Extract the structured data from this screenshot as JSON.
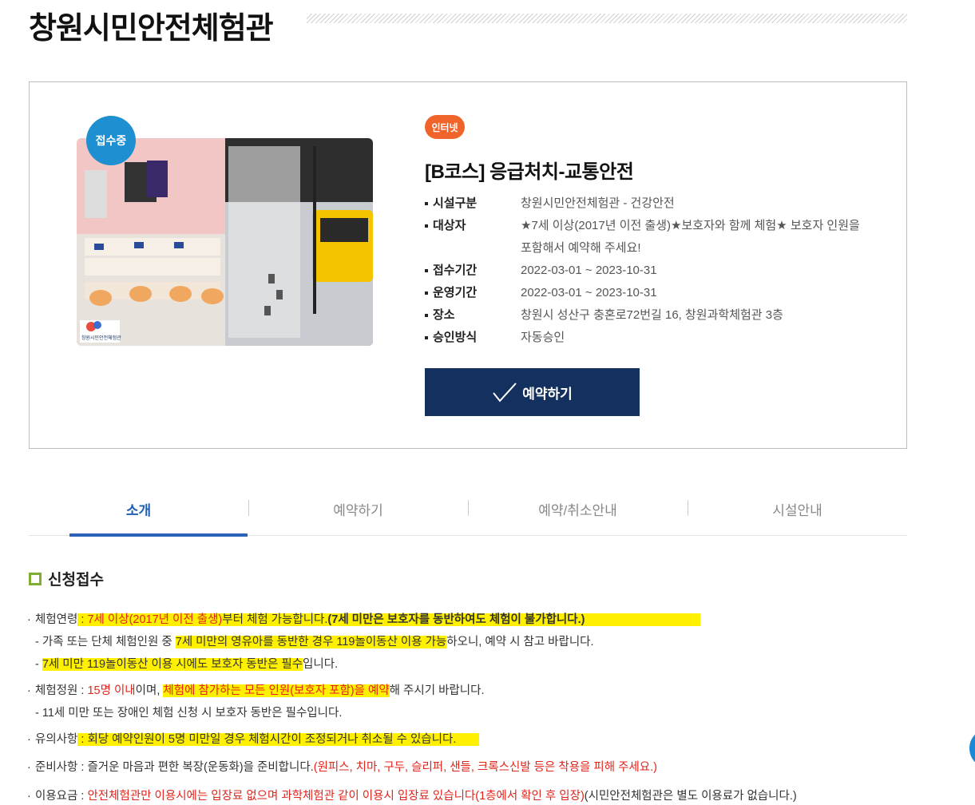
{
  "page": {
    "title": "창원시민안전체험관"
  },
  "card": {
    "status_badge": "접수중",
    "channel_chip": "인터넷",
    "course_title": "[B코스] 응급처치-교통안전",
    "photo_logo_text": "창원시민안전체험관",
    "info": [
      {
        "key": "시설구분",
        "value": "창원시민안전체험관 - 건강안전"
      },
      {
        "key": "대상자",
        "value": "★7세 이상(2017년 이전 출생)★보호자와 함께 체험★ 보호자 인원을",
        "value2": "포함해서 예약해 주세요!"
      },
      {
        "key": "접수기간",
        "value": "2022-03-01 ~ 2023-10-31"
      },
      {
        "key": "운영기간",
        "value": "2022-03-01 ~ 2023-10-31"
      },
      {
        "key": "장소",
        "value": "창원시 성산구 충혼로72번길 16, 창원과학체험관 3층"
      },
      {
        "key": "승인방식",
        "value": "자동승인"
      }
    ],
    "reserve_button": "예약하기"
  },
  "tabs": [
    "소개",
    "예약하기",
    "예약/취소안내",
    "시설안내"
  ],
  "section": {
    "title": "신청접수",
    "r1_label": "체험연령",
    "r1_red": "7세 이상(2017년 이전 출생)",
    "r1_rest": "부터 체험 가능합니다.",
    "r1_bold": "(7세 미만은 보호자를 동반하여도 체험이 불가합니다.)",
    "r1_sub1_a": "- 가족 또는 단체 체험인원 중 ",
    "r1_sub1_b": "7세 미만의 영유아를 동반한 경우 119놀이동산 이용 가능",
    "r1_sub1_c": "하오니, 예약 시 참고 바랍니다.",
    "r1_sub2_a": "- ",
    "r1_sub2_b": "7세 미만 119놀이동산 이용 시에도 보호자 동반은 필수",
    "r1_sub2_c": "입니다.",
    "r2_label": "체험정원",
    "r2_red": "15명 이내",
    "r2_mid": "이며, ",
    "r2_hl": "체험에 참가하는 모든 인원(보호자 포함)을 예약",
    "r2_rest": "해 주시기 바랍니다.",
    "r2_sub": "- 11세 미만 또는 장애인 체험 신청 시 보호자 동반은 필수입니다.",
    "r3_label": "유의사항",
    "r3_text": "회당 예약인원이 5명 미만일 경우 체험시간이 조정되거나 취소될 수 있습니다.",
    "r4_label": "준비사항",
    "r4_text": "즐거운 마음과 편한 복장(운동화)을 준비합니다.",
    "r4_red": "(원피스, 치마, 구두, 슬리퍼, 샌들, 크록스신발 등은 착용을 피해 주세요.)",
    "r5_label": "이용요금",
    "r5_red": "안전체험관만 이용시에는 입장료 없으며 과학체험관 같이 이용시 입장료 있습니다(1층에서 확인 후 입장)",
    "r5_rest": "(시민안전체험관은 별도 이용료가 없습니다.)"
  },
  "colors": {
    "accent_blue": "#14305e",
    "tab_active": "#2a63b8",
    "badge": "#1e8fd0",
    "chip": "#f0632a",
    "highlight": "#fff000",
    "red_text": "#e0251b"
  }
}
